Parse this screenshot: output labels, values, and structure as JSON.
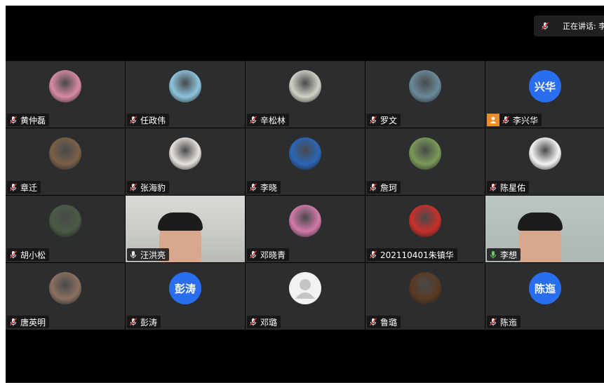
{
  "speaking_banner": {
    "label": "正在讲话: 李"
  },
  "participants": [
    {
      "name": "黄仲磊",
      "mic": "muted",
      "avatar": "photo",
      "color": "#d88aa6"
    },
    {
      "name": "任政伟",
      "mic": "muted",
      "avatar": "photo",
      "color": "#8cc4dc"
    },
    {
      "name": "辛松林",
      "mic": "muted",
      "avatar": "photo",
      "color": "#cfd2c6"
    },
    {
      "name": "罗文",
      "mic": "muted",
      "avatar": "photo",
      "color": "#6a8a9a"
    },
    {
      "name": "李兴华",
      "mic": "muted",
      "avatar": "text",
      "avatar_text": "兴华",
      "host": true
    },
    {
      "name": "章迁",
      "mic": "muted",
      "avatar": "photo",
      "color": "#7a6048"
    },
    {
      "name": "张海豹",
      "mic": "muted",
      "avatar": "photo",
      "color": "#e6e2dc"
    },
    {
      "name": "李晓",
      "mic": "muted",
      "avatar": "photo",
      "color": "#2a66b6"
    },
    {
      "name": "詹珂",
      "mic": "muted",
      "avatar": "photo",
      "color": "#7a9a58"
    },
    {
      "name": "陈星佑",
      "mic": "muted",
      "avatar": "photo",
      "color": "#f4f4f4"
    },
    {
      "name": "胡小松",
      "mic": "muted",
      "avatar": "photo",
      "color": "#4a5a44"
    },
    {
      "name": "汪洪亮",
      "mic": "on",
      "avatar": "video"
    },
    {
      "name": "邓晓青",
      "mic": "muted",
      "avatar": "photo",
      "color": "#d27aa8"
    },
    {
      "name": "202110401朱镇华",
      "mic": "muted",
      "avatar": "photo",
      "color": "#c8302a"
    },
    {
      "name": "李想",
      "mic": "speaking",
      "avatar": "video"
    },
    {
      "name": "唐英明",
      "mic": "muted",
      "avatar": "photo",
      "color": "#8a7060"
    },
    {
      "name": "彭涛",
      "mic": "muted",
      "avatar": "text",
      "avatar_text": "彭涛"
    },
    {
      "name": "邓璐",
      "mic": "muted",
      "avatar": "default"
    },
    {
      "name": "鲁璐",
      "mic": "muted",
      "avatar": "photo",
      "color": "#5a3a22"
    },
    {
      "name": "陈迤",
      "mic": "muted",
      "avatar": "text",
      "avatar_text": "陈迤"
    }
  ]
}
